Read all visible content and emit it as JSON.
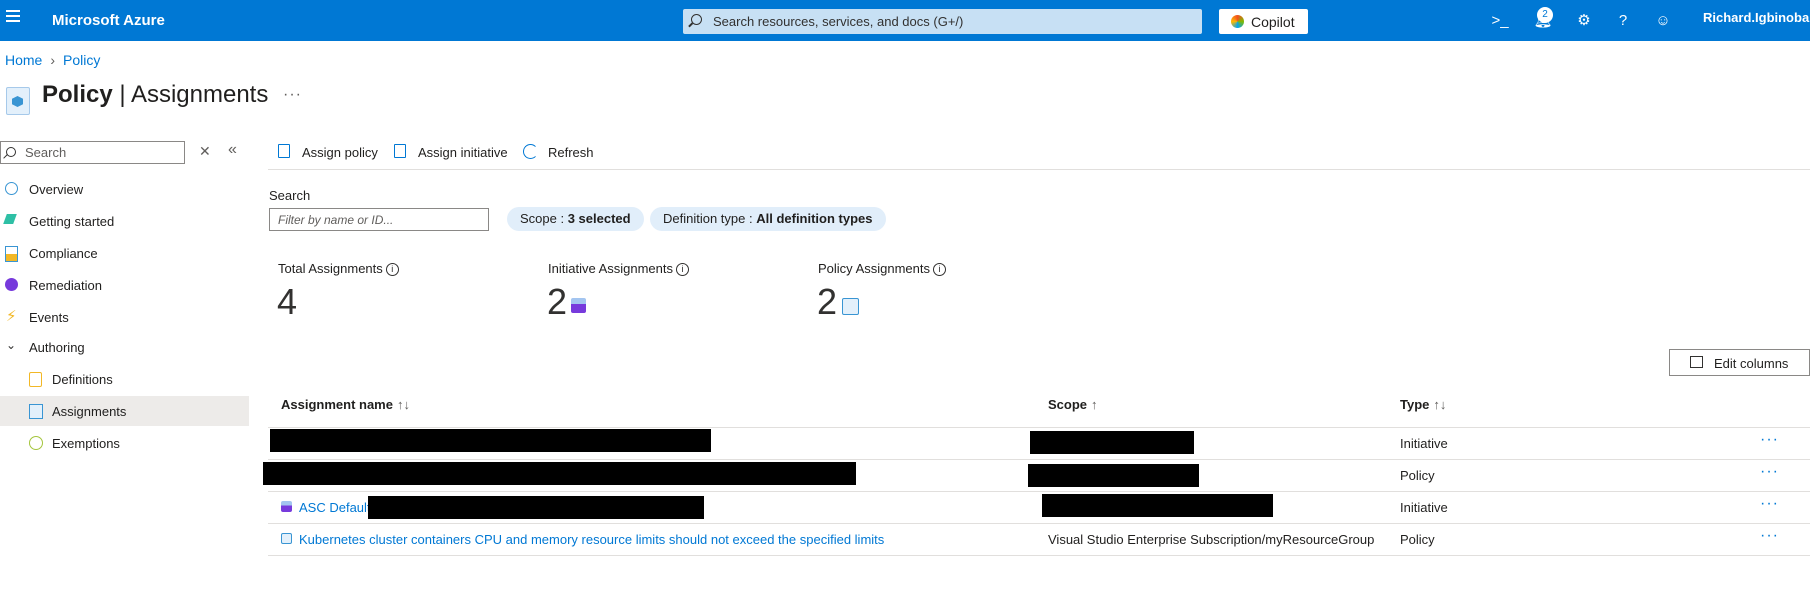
{
  "topbar": {
    "brand": "Microsoft Azure",
    "search_placeholder": "Search resources, services, and docs (G+/)",
    "copilot_label": "Copilot",
    "notification_count": "2",
    "user": "Richard.Igbinoba"
  },
  "breadcrumb": {
    "home": "Home",
    "current": "Policy"
  },
  "page": {
    "title_main": "Policy",
    "title_sep": "|",
    "title_sub": "Assignments",
    "more": "···"
  },
  "sidebar": {
    "search_placeholder": "Search",
    "items": [
      {
        "label": "Overview",
        "icon": "overview-icon"
      },
      {
        "label": "Getting started",
        "icon": "rocket-icon"
      },
      {
        "label": "Compliance",
        "icon": "compliance-icon"
      },
      {
        "label": "Remediation",
        "icon": "remediation-icon"
      },
      {
        "label": "Events",
        "icon": "lightning-icon"
      },
      {
        "label": "Authoring",
        "icon": "chevron-down-icon"
      },
      {
        "label": "Definitions",
        "icon": "definitions-icon"
      },
      {
        "label": "Assignments",
        "icon": "assignments-icon",
        "selected": true
      },
      {
        "label": "Exemptions",
        "icon": "exemptions-icon"
      }
    ]
  },
  "toolbar": {
    "assign_policy": "Assign policy",
    "assign_initiative": "Assign initiative",
    "refresh": "Refresh"
  },
  "filters": {
    "search_label": "Search",
    "search_placeholder": "Filter by name or ID...",
    "scope_key": "Scope : ",
    "scope_value": "3 selected",
    "deftype_key": "Definition type : ",
    "deftype_value": "All definition types"
  },
  "stats": {
    "total_label": "Total Assignments",
    "total_value": "4",
    "initiative_label": "Initiative Assignments",
    "initiative_value": "2",
    "policy_label": "Policy Assignments",
    "policy_value": "2"
  },
  "edit_columns": "Edit columns",
  "table": {
    "headers": {
      "name": "Assignment name",
      "name_sort": "↑↓",
      "scope": "Scope",
      "scope_sort": "↑",
      "type": "Type",
      "type_sort": "↑↓"
    },
    "rows": [
      {
        "name": "",
        "scope": "",
        "type": "Initiative",
        "more": "···"
      },
      {
        "name": "",
        "scope": "",
        "type": "Policy",
        "more": "···"
      },
      {
        "name": "ASC Default",
        "scope": "",
        "type": "Initiative",
        "more": "···"
      },
      {
        "name": "Kubernetes cluster containers CPU and memory resource limits should not exceed the specified limits",
        "scope": "Visual Studio Enterprise Subscription/myResourceGroup",
        "type": "Policy",
        "more": "···"
      }
    ]
  },
  "colors": {
    "accent": "#0078d4",
    "selected_bg": "#edebe9",
    "pill_bg": "#e1eefa"
  }
}
